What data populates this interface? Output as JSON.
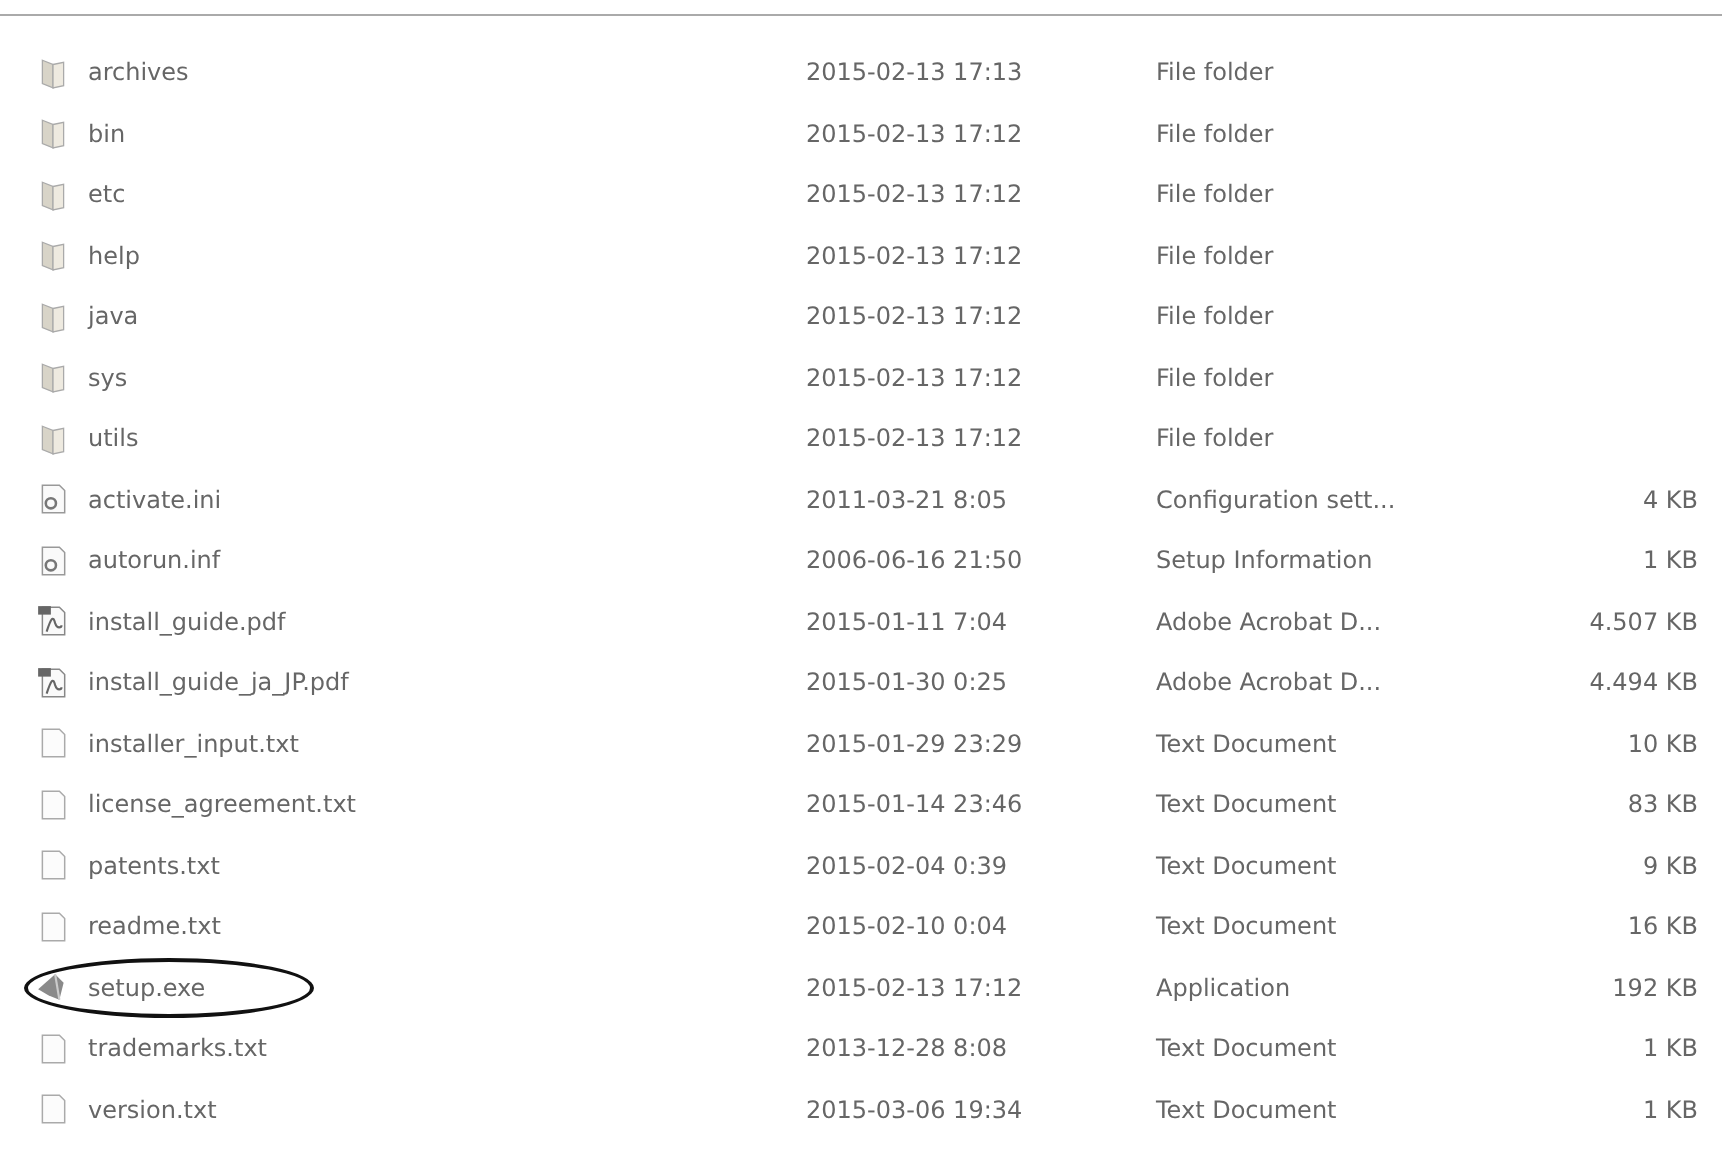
{
  "files": [
    {
      "kind": "folder",
      "name": "archives",
      "date": "2015-02-13 17:13",
      "type": "File folder",
      "circled": false
    },
    {
      "kind": "folder",
      "name": "bin",
      "date": "2015-02-13 17:12",
      "type": "File folder",
      "circled": false
    },
    {
      "kind": "folder",
      "name": "etc",
      "date": "2015-02-13 17:12",
      "type": "File folder",
      "circled": false
    },
    {
      "kind": "folder",
      "name": "help",
      "date": "2015-02-13 17:12",
      "type": "File folder",
      "circled": false
    },
    {
      "kind": "folder",
      "name": "java",
      "date": "2015-02-13 17:12",
      "type": "File folder",
      "circled": false
    },
    {
      "kind": "folder",
      "name": "sys",
      "date": "2015-02-13 17:12",
      "type": "File folder",
      "circled": false
    },
    {
      "kind": "folder",
      "name": "utils",
      "date": "2015-02-13 17:12",
      "type": "File folder",
      "circled": false
    },
    {
      "kind": "settings",
      "name": "activate.ini",
      "date": "2011-03-21 8:05",
      "type": "Configuration sett...",
      "size": "4 KB",
      "circled": false
    },
    {
      "kind": "settings",
      "name": "autorun.inf",
      "date": "2006-06-16 21:50",
      "type": "Setup Information",
      "size": "1 KB",
      "circled": false
    },
    {
      "kind": "pdf",
      "name": "install_guide.pdf",
      "date": "2015-01-11 7:04",
      "type": "Adobe Acrobat D...",
      "size": "4.507 KB",
      "circled": false
    },
    {
      "kind": "pdf",
      "name": "install_guide_ja_JP.pdf",
      "date": "2015-01-30 0:25",
      "type": "Adobe Acrobat D...",
      "size": "4.494 KB",
      "circled": false
    },
    {
      "kind": "text",
      "name": "installer_input.txt",
      "date": "2015-01-29 23:29",
      "type": "Text Document",
      "size": "10 KB",
      "circled": false
    },
    {
      "kind": "text",
      "name": "license_agreement.txt",
      "date": "2015-01-14 23:46",
      "type": "Text Document",
      "size": "83 KB",
      "circled": false
    },
    {
      "kind": "text",
      "name": "patents.txt",
      "date": "2015-02-04 0:39",
      "type": "Text Document",
      "size": "9 KB",
      "circled": false
    },
    {
      "kind": "text",
      "name": "readme.txt",
      "date": "2015-02-10 0:04",
      "type": "Text Document",
      "size": "16 KB",
      "circled": false
    },
    {
      "kind": "app",
      "name": "setup.exe",
      "date": "2015-02-13 17:12",
      "type": "Application",
      "size": "192 KB",
      "circled": true
    },
    {
      "kind": "text",
      "name": "trademarks.txt",
      "date": "2013-12-28 8:08",
      "type": "Text Document",
      "size": "1 KB",
      "circled": false
    },
    {
      "kind": "text",
      "name": "version.txt",
      "date": "2015-03-06 19:34",
      "type": "Text Document",
      "size": "1 KB",
      "circled": false
    }
  ]
}
